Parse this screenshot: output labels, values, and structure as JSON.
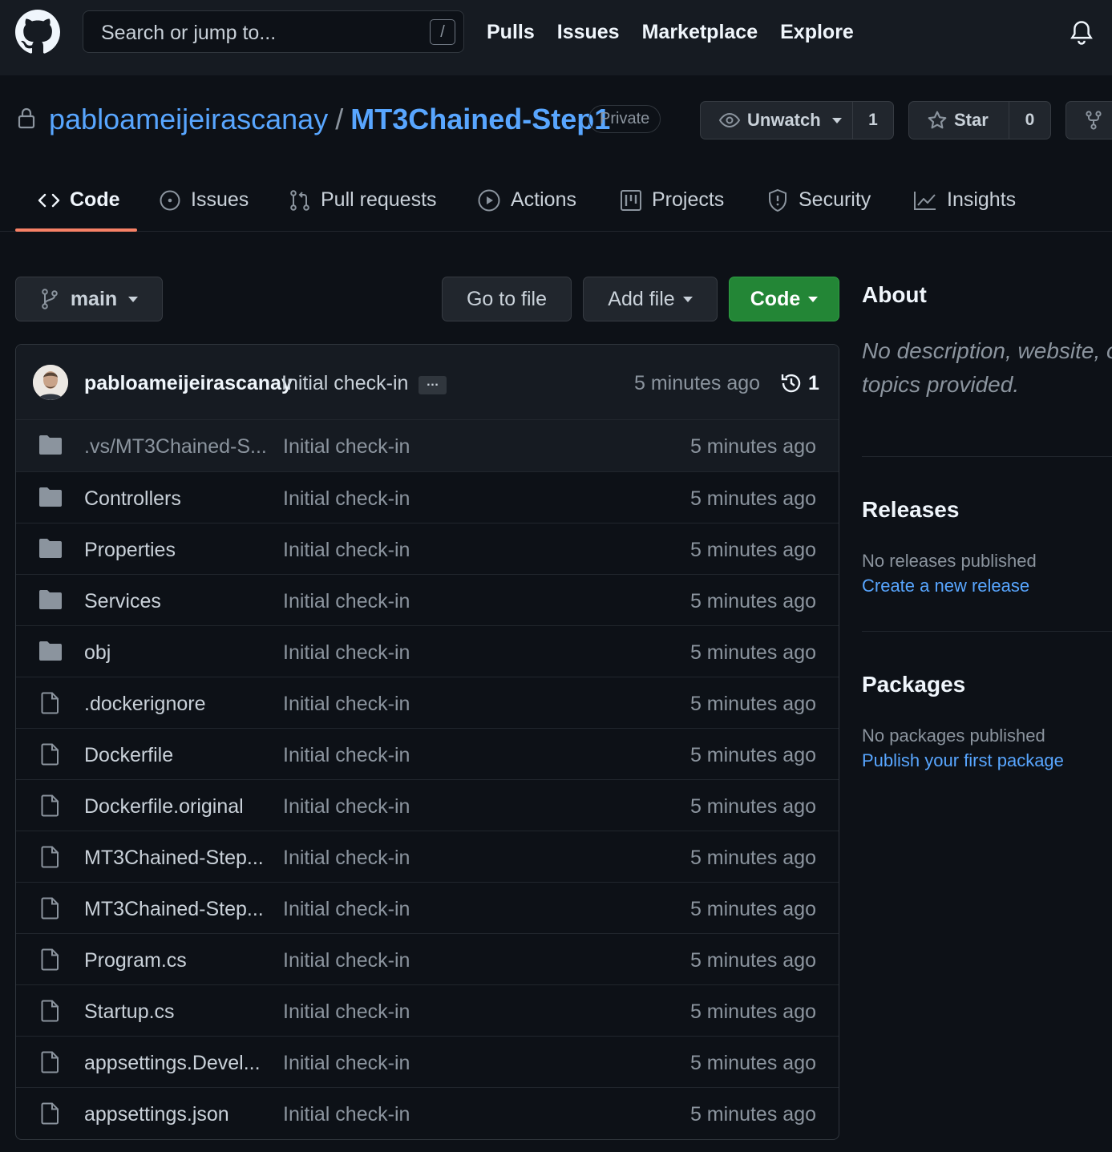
{
  "header": {
    "search_placeholder": "Search or jump to...",
    "search_key": "/",
    "nav": [
      "Pulls",
      "Issues",
      "Marketplace",
      "Explore"
    ]
  },
  "repo": {
    "owner": "pabloameijeirascanay",
    "separator": "/",
    "name": "MT3Chained-Step1",
    "visibility": "Private",
    "watch_label": "Unwatch",
    "watch_count": "1",
    "star_label": "Star",
    "star_count": "0"
  },
  "tabs": [
    {
      "label": "Code",
      "icon": "code-icon",
      "selected": true
    },
    {
      "label": "Issues",
      "icon": "issue-icon"
    },
    {
      "label": "Pull requests",
      "icon": "pull-request-icon"
    },
    {
      "label": "Actions",
      "icon": "play-icon"
    },
    {
      "label": "Projects",
      "icon": "project-icon"
    },
    {
      "label": "Security",
      "icon": "shield-icon"
    },
    {
      "label": "Insights",
      "icon": "graph-icon"
    }
  ],
  "file_nav": {
    "branch": "main",
    "go_to_file": "Go to file",
    "add_file": "Add file",
    "code": "Code"
  },
  "commit": {
    "author": "pabloameijeirascanay",
    "message": "Initial check-in",
    "ellipsis": "…",
    "time": "5 minutes ago",
    "history_count": "1"
  },
  "files": [
    {
      "name": ".vs/MT3Chained-S...",
      "type": "dir",
      "message": "Initial check-in",
      "age": "5 minutes ago"
    },
    {
      "name": "Controllers",
      "type": "dir",
      "message": "Initial check-in",
      "age": "5 minutes ago"
    },
    {
      "name": "Properties",
      "type": "dir",
      "message": "Initial check-in",
      "age": "5 minutes ago"
    },
    {
      "name": "Services",
      "type": "dir",
      "message": "Initial check-in",
      "age": "5 minutes ago"
    },
    {
      "name": "obj",
      "type": "dir",
      "message": "Initial check-in",
      "age": "5 minutes ago"
    },
    {
      "name": ".dockerignore",
      "type": "file",
      "message": "Initial check-in",
      "age": "5 minutes ago"
    },
    {
      "name": "Dockerfile",
      "type": "file",
      "message": "Initial check-in",
      "age": "5 minutes ago"
    },
    {
      "name": "Dockerfile.original",
      "type": "file",
      "message": "Initial check-in",
      "age": "5 minutes ago"
    },
    {
      "name": "MT3Chained-Step...",
      "type": "file",
      "message": "Initial check-in",
      "age": "5 minutes ago"
    },
    {
      "name": "MT3Chained-Step...",
      "type": "file",
      "message": "Initial check-in",
      "age": "5 minutes ago"
    },
    {
      "name": "Program.cs",
      "type": "file",
      "message": "Initial check-in",
      "age": "5 minutes ago"
    },
    {
      "name": "Startup.cs",
      "type": "file",
      "message": "Initial check-in",
      "age": "5 minutes ago"
    },
    {
      "name": "appsettings.Devel...",
      "type": "file",
      "message": "Initial check-in",
      "age": "5 minutes ago"
    },
    {
      "name": "appsettings.json",
      "type": "file",
      "message": "Initial check-in",
      "age": "5 minutes ago"
    }
  ],
  "sidebar": {
    "about_title": "About",
    "about_desc": "No description, website, or topics provided.",
    "releases_title": "Releases",
    "releases_none": "No releases published",
    "releases_link": "Create a new release",
    "packages_title": "Packages",
    "packages_none": "No packages published",
    "packages_link": "Publish your first package"
  },
  "colors": {
    "page_bg": "#0d1117",
    "header_bg": "#161b22",
    "link": "#58a6ff",
    "primary_button": "#238636",
    "tab_underline": "#f78166"
  }
}
